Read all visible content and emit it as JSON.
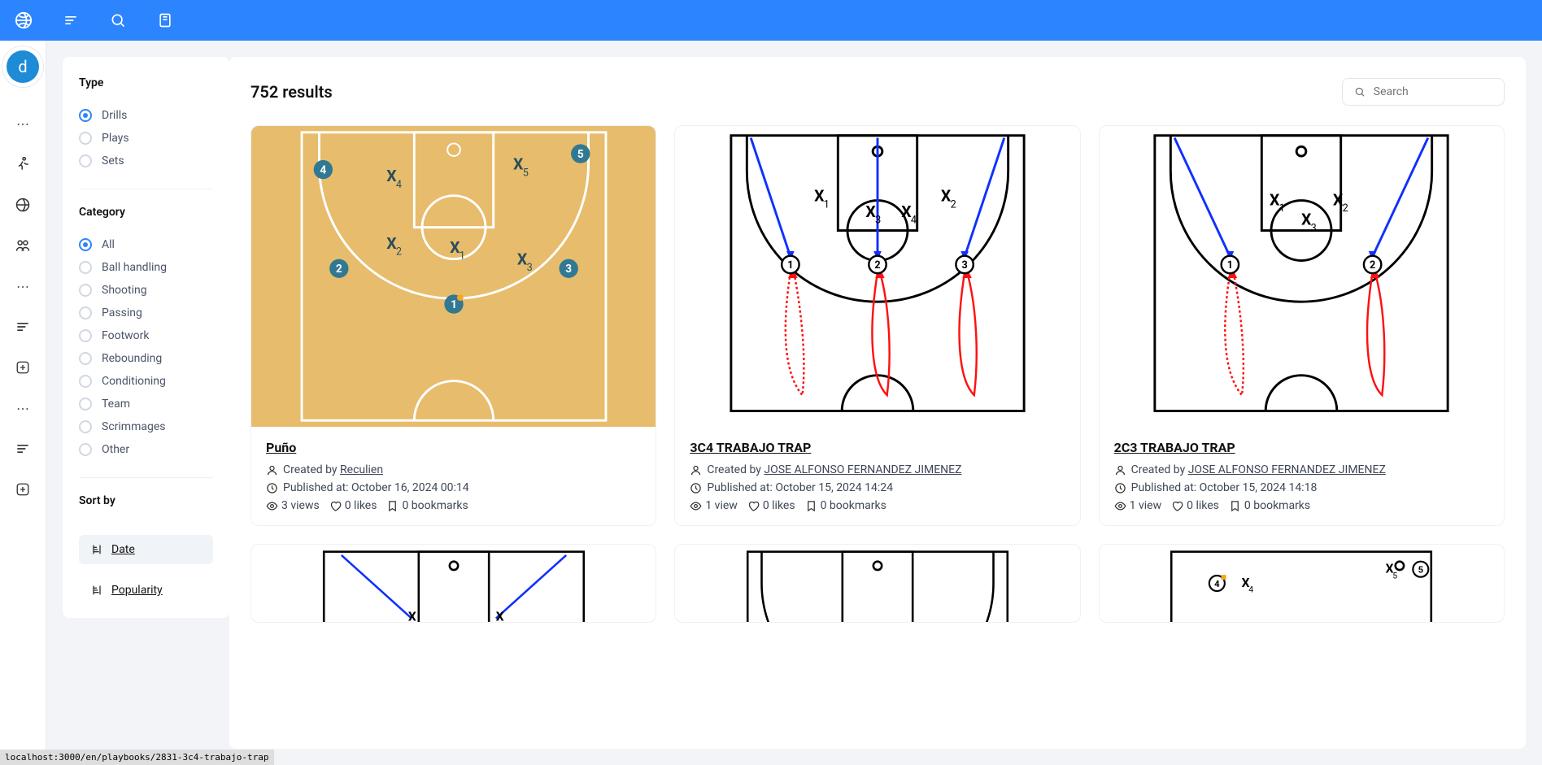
{
  "avatar_letter": "d",
  "status_url": "localhost:3000/en/playbooks/2831-3c4-trabajo-trap",
  "filters": {
    "type": {
      "heading": "Type",
      "options": [
        "Drills",
        "Plays",
        "Sets"
      ],
      "selected": 0
    },
    "category": {
      "heading": "Category",
      "options": [
        "All",
        "Ball handling",
        "Shooting",
        "Passing",
        "Footwork",
        "Rebounding",
        "Conditioning",
        "Team",
        "Scrimmages",
        "Other"
      ],
      "selected": 0
    },
    "sort": {
      "heading": "Sort by",
      "options": [
        "Date",
        "Popularity"
      ],
      "selected": 0
    }
  },
  "results": {
    "count_text": "752 results",
    "search_placeholder": "Search"
  },
  "cards": [
    {
      "title": "Puño",
      "author_prefix": "Created by ",
      "author": "Reculien",
      "published_prefix": "Published at: ",
      "published": "October 16, 2024 00:14",
      "views": "3 views",
      "likes": "0 likes",
      "bookmarks": "0 bookmarks"
    },
    {
      "title": "3C4 TRABAJO TRAP",
      "author_prefix": "Created by ",
      "author": "JOSE ALFONSO FERNANDEZ JIMENEZ",
      "published_prefix": "Published at: ",
      "published": "October 15, 2024 14:24",
      "views": "1 view",
      "likes": "0 likes",
      "bookmarks": "0 bookmarks"
    },
    {
      "title": "2C3 TRABAJO TRAP",
      "author_prefix": "Created by ",
      "author": "JOSE ALFONSO FERNANDEZ JIMENEZ",
      "published_prefix": "Published at: ",
      "published": "October 15, 2024 14:18",
      "views": "1 view",
      "likes": "0 likes",
      "bookmarks": "0 bookmarks"
    }
  ]
}
